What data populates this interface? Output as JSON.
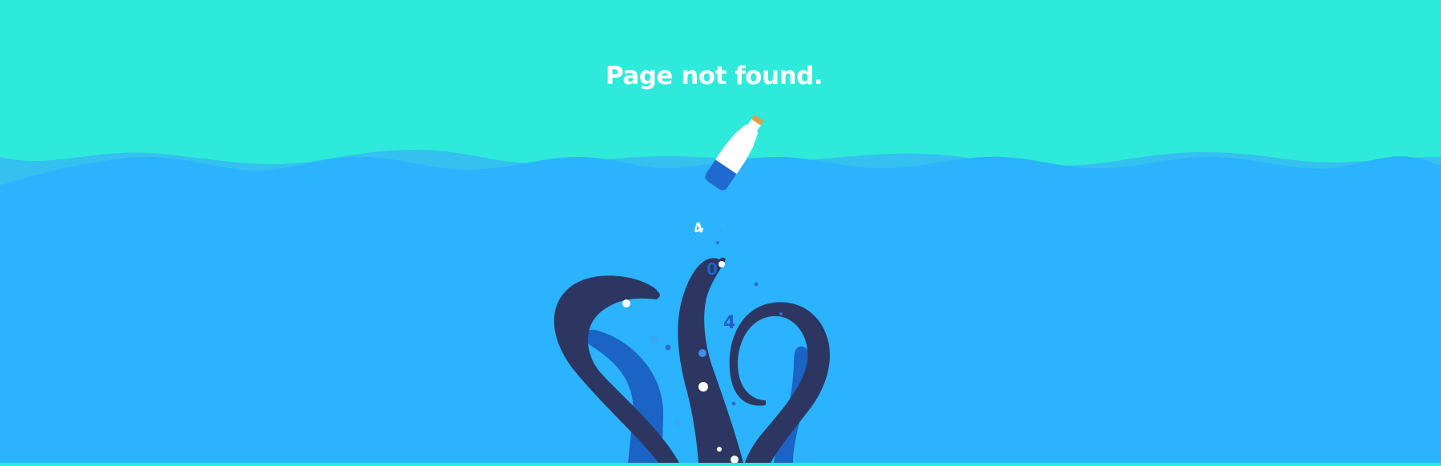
{
  "page": {
    "title": "Page not found."
  },
  "illustration": {
    "falling_digits": [
      "4",
      "0",
      "4"
    ],
    "colors": {
      "sky": "#2eeada",
      "sea": "#2bb3ff",
      "sea_back_wave": "#35c1f0",
      "tentacle_dark": "#2c3660",
      "tentacle_light": "#1b63c4",
      "bottle": "#ffffff",
      "bottle_water": "#1e6ad0",
      "cork": "#d9a24a"
    },
    "icons": [
      "bottle-icon",
      "octopus-tentacles-icon"
    ]
  }
}
